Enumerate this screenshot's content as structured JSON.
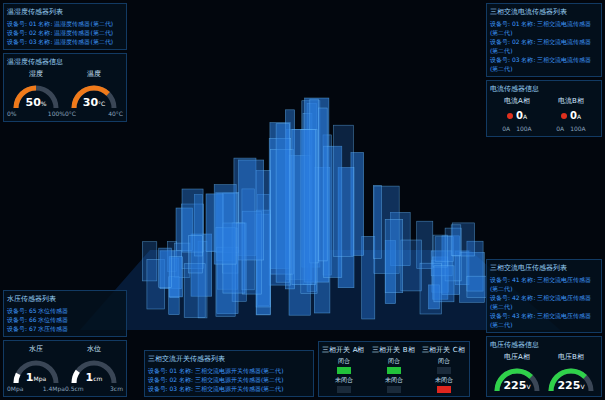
{
  "temp_humidity_list": {
    "title": "温湿度传感器列表",
    "rows": [
      "设备号: 01 名称: 温湿度传感器(第二代)",
      "设备号: 02 名称: 温湿度传感器(第二代)",
      "设备号: 03 名称: 温湿度传感器(第二代)"
    ]
  },
  "temp_humidity_info": {
    "title": "温湿度传感器信息",
    "gauges": [
      {
        "label": "湿度",
        "value": "50",
        "unit": "%",
        "min": "0%",
        "max": "100%",
        "level": 0.5,
        "color": "#f07a1a"
      },
      {
        "label": "温度",
        "value": "30",
        "unit": "°C",
        "min": "0°C",
        "max": "40°C",
        "level": 0.75,
        "color": "#f07a1a"
      }
    ]
  },
  "water_list": {
    "title": "水压传感器列表",
    "rows": [
      "设备号: 65 水位传感器",
      "设备号: 66 水位传感器",
      "设备号: 67 水压传感器"
    ]
  },
  "water_gauges": [
    {
      "label": "水压",
      "value": "1",
      "unit": "Mpa",
      "min": "0Mpa",
      "max": "1.4Mpa",
      "level": 0.15,
      "color": "#ffffff"
    },
    {
      "label": "水位",
      "value": "1",
      "unit": "cm",
      "min": "0.5cm",
      "max": "3cm",
      "level": 0.2,
      "color": "#ffffff"
    }
  ],
  "switch_list": {
    "title": "三相交流开关传感器列表",
    "rows": [
      "设备号: 01 名称: 三相交流电源开关传感器(第二代)",
      "设备号: 02 名称: 三相交流电源开关传感器(第二代)",
      "设备号: 03 名称: 三相交流电源开关传感器(第二代)"
    ]
  },
  "switches": [
    {
      "label": "三相开关 A相",
      "closed_text": "闭合",
      "open_text": "未闭合",
      "closed": true
    },
    {
      "label": "三相开关 B相",
      "closed_text": "闭合",
      "open_text": "未闭合",
      "closed": true
    },
    {
      "label": "三相开关 C相",
      "closed_text": "闭合",
      "open_text": "未闭合",
      "closed": false
    }
  ],
  "current_list": {
    "title": "三相交流电流传感器列表",
    "rows": [
      "设备号: 01 名称: 三相交流电流传感器(第二代)",
      "设备号: 02 名称: 三相交流电流传感器(第二代)",
      "设备号: 03 名称: 三相交流电流传感器(第二代)"
    ]
  },
  "current_info": {
    "title": "电流传感器信息",
    "readings": [
      {
        "label": "电流A相",
        "value": "0",
        "unit": "A",
        "min": "0A",
        "max": "100A",
        "color": "#e0301e"
      },
      {
        "label": "电流B相",
        "value": "0",
        "unit": "A",
        "min": "0A",
        "max": "100A",
        "color": "#e0301e"
      }
    ]
  },
  "voltage_list": {
    "title": "三相交流电压传感器列表",
    "rows": [
      "设备号: 41 名称: 三相交流电压传感器(第二代)",
      "设备号: 42 名称: 三相交流电压传感器(第二代)",
      "设备号: 43 名称: 三相交流电压传感器(第二代)"
    ]
  },
  "voltage_info": {
    "title": "电压传感器信息",
    "gauges": [
      {
        "label": "电压A相",
        "value": "225",
        "unit": "V",
        "level": 0.75,
        "color": "#2fd14a"
      },
      {
        "label": "电压B相",
        "value": "225",
        "unit": "V",
        "level": 0.75,
        "color": "#2fd14a"
      }
    ]
  }
}
